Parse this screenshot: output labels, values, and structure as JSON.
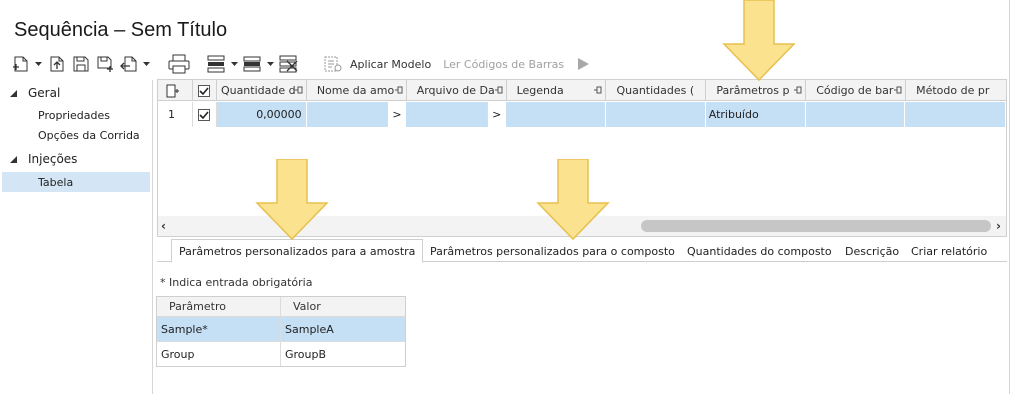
{
  "window": {
    "title": "Sequência – Sem Título"
  },
  "toolbar": {
    "apply_template_label": "Aplicar Modelo",
    "read_barcodes_label": "Ler Códigos de Barras"
  },
  "tree": {
    "categories": [
      {
        "label": "Geral",
        "items": [
          "Propriedades",
          "Opções da Corrida"
        ]
      },
      {
        "label": "Injeções",
        "items": [
          "Tabela"
        ]
      }
    ],
    "selected_item": "Tabela"
  },
  "grid": {
    "columns": [
      "",
      "",
      "Quantidade d",
      "Nome da amo",
      "Arquivo de Da",
      "Legenda",
      "Quantidades (",
      "Parâmetros p",
      "Código de bar",
      "Método de pr"
    ],
    "rows": [
      {
        "index": "1",
        "checked": true,
        "quantity": "0,00000",
        "sample_name": "",
        "sample_name_button": ">",
        "data_file": "",
        "data_file_button": ">",
        "legend": "",
        "quantities": "",
        "parameters": "Atribuído",
        "barcode": "",
        "method": ""
      }
    ]
  },
  "tabs": [
    "Parâmetros personalizados para a amostra",
    "Parâmetros personalizados para o composto",
    "Quantidades do composto",
    "Descrição",
    "Criar relatório"
  ],
  "active_tab": "Parâmetros personalizados para a amostra",
  "required_note": "* Indica entrada obrigatória",
  "params_table": {
    "headers": [
      "Parâmetro",
      "Valor"
    ],
    "rows": [
      {
        "param": "Sample*",
        "value": "SampleA"
      },
      {
        "param": "Group",
        "value": "GroupB"
      }
    ]
  },
  "colors": {
    "selection": "#c5dff5",
    "tree_selection": "#d4e6f6",
    "callout_fill": "#fbe28f",
    "callout_stroke": "#e7c04e"
  }
}
